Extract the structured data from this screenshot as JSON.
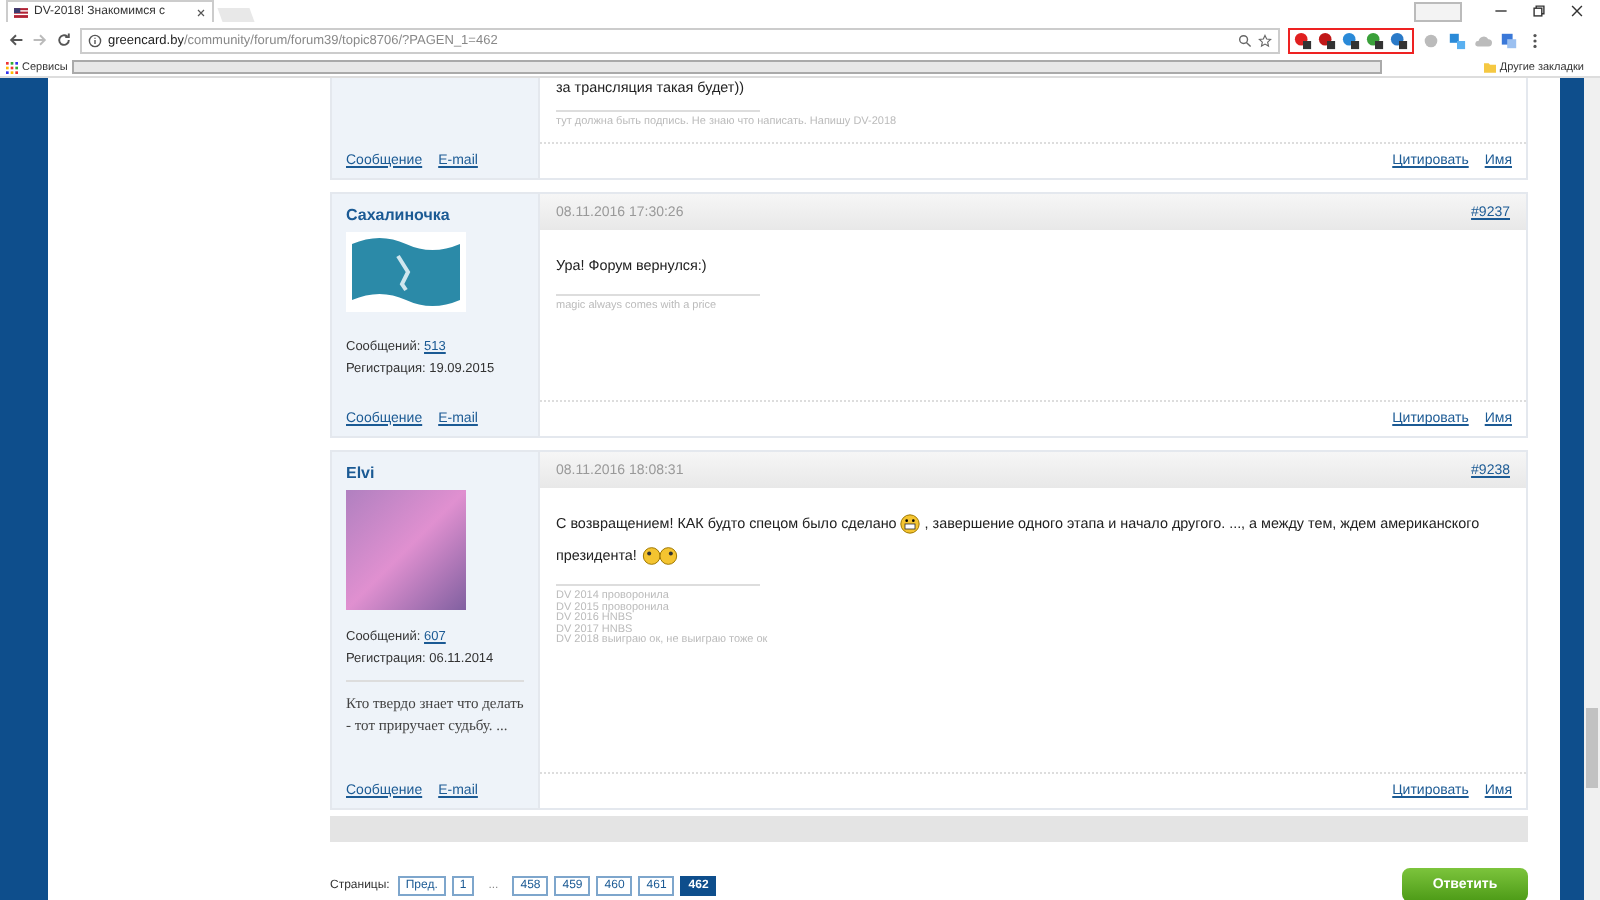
{
  "browser": {
    "tab_title": "DV-2018! Знакомимся с",
    "url_host": "greencard.by",
    "url_path": "/community/forum/forum39/topic8706/?PAGEN_1=462",
    "bookmarks": [
      {
        "label": "Сервисы",
        "kind": "apps"
      },
      {
        "label": "Другие закладки",
        "kind": "folder"
      }
    ]
  },
  "posts": [
    {
      "kind": "continued",
      "body_lines": [
        [
          {
            "kind": "text",
            "text": "за трансляция такая будет))"
          }
        ]
      ],
      "signature": [
        "тут должна быть подпись. Не знаю что написать. Напишу DV-2018"
      ],
      "links_left": [
        "Сообщение",
        "E-mail"
      ],
      "links_right": [
        "Цитировать",
        "Имя"
      ]
    },
    {
      "kind": "full",
      "author": "Сахалиночка",
      "date": "08.11.2016 17:30:26",
      "permalink": "#9237",
      "body_lines": [
        [
          {
            "kind": "text",
            "text": "Ура! Форум вернулся:)"
          }
        ]
      ],
      "signature": [
        "magic always comes with a price"
      ],
      "avatar": {
        "kind": "flag"
      },
      "messages_label": "Сообщений:",
      "messages": "513",
      "registration": "Регистрация: 19.09.2015",
      "links_left": [
        "Сообщение",
        "E-mail"
      ],
      "links_right": [
        "Цитировать",
        "Имя"
      ]
    },
    {
      "kind": "full",
      "author": "Elvi",
      "date": "08.11.2016 18:08:31",
      "permalink": "#9238",
      "body_lines": [
        [
          {
            "kind": "text",
            "text": "С возвращением! КАК будто спецом было сделано"
          },
          {
            "kind": "smiley"
          },
          {
            "kind": "text",
            "text": ", завершение одного этапа и начало другого. ..., а между тем, ждем американского"
          }
        ],
        [
          {
            "kind": "text",
            "text": "президента!"
          },
          {
            "kind": "smiley2"
          }
        ]
      ],
      "signature": [
        "DV 2014 проворонила",
        "DV 2015 проворонила",
        "DV 2016 HNBS",
        "DV 2017 HNBS",
        "DV 2018 выиграю ок, не выиграю тоже ок"
      ],
      "avatar": {
        "kind": "picture"
      },
      "messages_label": "Сообщений:",
      "messages": "607",
      "registration": "Регистрация: 06.11.2014",
      "motto": "Кто твердо знает что делать - тот приручает судьбу. ...",
      "links_left": [
        "Сообщение",
        "E-mail"
      ],
      "links_right": [
        "Цитировать",
        "Имя"
      ]
    }
  ],
  "pagination": {
    "label": "Страницы:",
    "items": [
      {
        "text": "Пред.",
        "kind": "link",
        "selected": false
      },
      {
        "text": "1",
        "kind": "link",
        "selected": false
      },
      {
        "text": "...",
        "kind": "gap",
        "selected": false
      },
      {
        "text": "458",
        "kind": "link",
        "selected": false
      },
      {
        "text": "459",
        "kind": "link",
        "selected": false
      },
      {
        "text": "460",
        "kind": "link",
        "selected": false
      },
      {
        "text": "461",
        "kind": "link",
        "selected": false
      },
      {
        "text": "462",
        "kind": "link",
        "selected": true
      }
    ]
  },
  "reply_button": "Ответить"
}
